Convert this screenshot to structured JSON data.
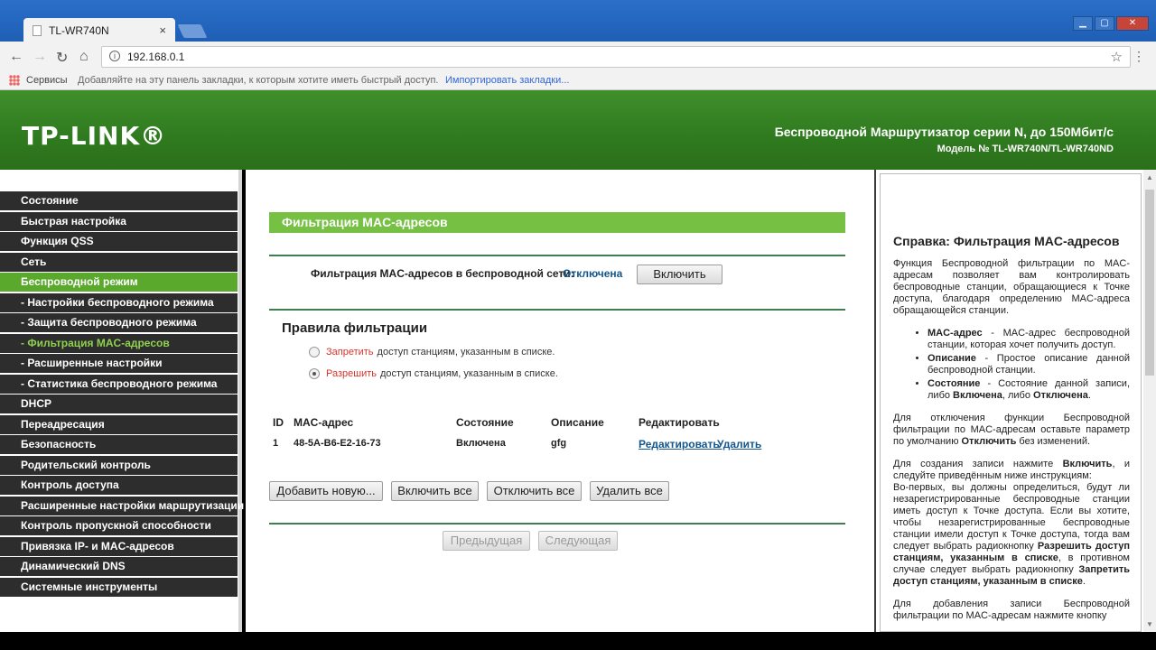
{
  "browser": {
    "tab_title": "TL-WR740N",
    "tab_close": "×",
    "url": "192.168.0.1",
    "back_icon": "←",
    "forward_icon": "→",
    "reload_icon": "↻",
    "home_icon": "⌂",
    "star_icon": "☆",
    "menu_icon": "⋮",
    "window_buttons": {
      "minimize": "▁",
      "maximize": "▢",
      "close": "✕"
    },
    "bookmarks": {
      "services": "Сервисы",
      "hint": "Добавляйте на эту панель закладки, к которым хотите иметь быстрый доступ.",
      "import": "Импортировать закладки..."
    }
  },
  "header": {
    "logo": "TP-LINK®",
    "title": "Беспроводной Маршрутизатор серии N, до 150Мбит/с",
    "model": "Модель № TL-WR740N/TL-WR740ND"
  },
  "sidebar": {
    "items": [
      {
        "label": "Состояние"
      },
      {
        "label": "Быстрая настройка"
      },
      {
        "label": "Функция QSS"
      },
      {
        "label": "Сеть"
      },
      {
        "label": "Беспроводной режим"
      },
      {
        "label": "- Настройки беспроводного режима"
      },
      {
        "label": "- Защита беспроводного режима"
      },
      {
        "label": "- Фильтрация MAC-адресов"
      },
      {
        "label": "- Расширенные настройки"
      },
      {
        "label": "- Статистика беспроводного режима"
      },
      {
        "label": "DHCP"
      },
      {
        "label": "Переадресация"
      },
      {
        "label": "Безопасность"
      },
      {
        "label": "Родительский контроль"
      },
      {
        "label": "Контроль доступа"
      },
      {
        "label": "Расширенные настройки маршрутизации"
      },
      {
        "label": "Контроль пропускной способности"
      },
      {
        "label": "Привязка IP- и MAC-адресов"
      },
      {
        "label": "Динамический DNS"
      },
      {
        "label": "Системные инструменты"
      }
    ]
  },
  "main": {
    "title": "Фильтрация MAC-адресов",
    "filter_label": "Фильтрация MAC-адресов в беспроводной сети:",
    "filter_status": "Отключена",
    "enable_button": "Включить",
    "rules_title": "Правила фильтрации",
    "deny": {
      "keyword": "Запретить",
      "rest": "доступ станциям, указанным в списке.",
      "selected": false
    },
    "allow": {
      "keyword": "Разрешить",
      "rest": "доступ станциям, указанным в списке.",
      "selected": true
    },
    "table": {
      "headers": {
        "id": "ID",
        "mac": "MAC-адрес",
        "state": "Состояние",
        "desc": "Описание",
        "edit": "Редактировать"
      },
      "rows": [
        {
          "id": "1",
          "mac": "48-5A-B6-E2-16-73",
          "state": "Включена",
          "desc": "gfg",
          "edit": "Редактировать",
          "delete": "Удалить"
        }
      ]
    },
    "buttons": {
      "add_new": "Добавить новую...",
      "enable_all": "Включить все",
      "disable_all": "Отключить все",
      "delete_all": "Удалить все",
      "prev": "Предыдущая",
      "next": "Следующая"
    }
  },
  "help": {
    "title": "Справка: Фильтрация MAC-адресов",
    "intro": "Функция Беспроводной фильтрации по MAC-адресам позволяет вам контролировать беспроводные станции, обращающиеся к Точке доступа, благодаря определению MAC-адреса обращающейся станции.",
    "bullets": [
      {
        "term": "MAC-адрес",
        "text": " - MAC-адрес беспроводной станции, которая хочет получить доступ."
      },
      {
        "term": "Описание",
        "text": " - Простое описание данной беспроводной станции."
      },
      {
        "term": "Состояние",
        "text": " - Состояние данной записи, либо ",
        "b2": "Включена",
        "mid": ", либо ",
        "b3": "Отключена",
        "end": "."
      }
    ],
    "p_disable_a": "Для отключения функции Беспроводной фильтрации по MAC-адресам оставьте параметр по умолчанию ",
    "p_disable_b": "Отключить",
    "p_disable_c": " без изменений.",
    "p_create_a": "Для создания записи нажмите ",
    "p_create_b": "Включить",
    "p_create_c": ", и следуйте приведённым ниже инструкциям:",
    "p_create_d": "Во-первых, вы должны определиться, будут ли незарегистрированные беспроводные станции иметь доступ к Точке доступа. Если вы хотите, чтобы незарегистрированные беспроводные станции имели доступ к Точке доступа, тогда вам следует выбрать радиокнопку ",
    "p_create_e": "Разрешить доступ станциям, указанным в списке",
    "p_create_f": ", в противном случае следует выбрать радиокнопку ",
    "p_create_g": "Запретить доступ станциям, указанным в списке",
    "p_create_h": ".",
    "p_add": "Для добавления записи Беспроводной фильтрации по MAC-адресам нажмите кнопку"
  }
}
